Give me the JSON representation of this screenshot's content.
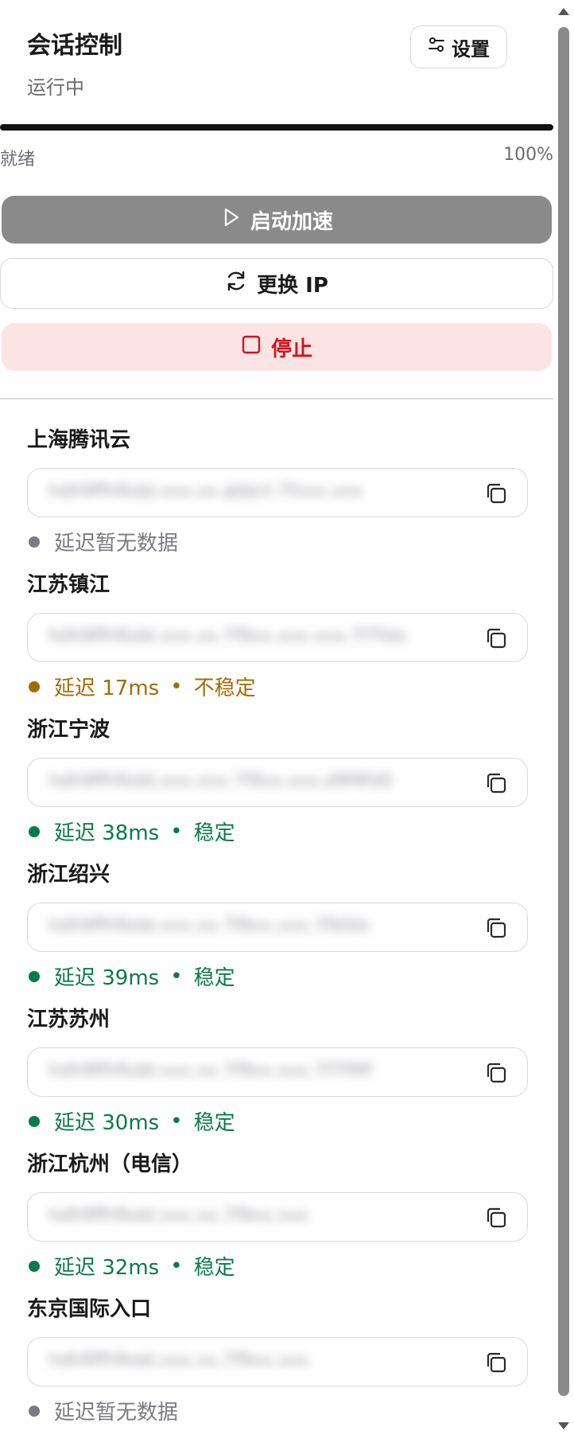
{
  "header": {
    "title": "会话控制",
    "status": "运行中",
    "settings_label": "设置"
  },
  "progress": {
    "label": "就绪",
    "percent_text": "100%",
    "value": 1.0
  },
  "actions": {
    "start_label": "启动加速",
    "change_ip_label": "更换 IP",
    "stop_label": "停止"
  },
  "colors": {
    "stable": "#0b7a4b",
    "unstable": "#a36b07",
    "none": "#7a7a82",
    "stop_text": "#d0141c",
    "stop_bg": "#fce4e4"
  },
  "nodes": [
    {
      "name": "上海腾讯云",
      "value": "hdh9ffhfkdd.xxx.xx.abbct.7fxxx.xxx",
      "latency_text": "延迟暂无数据",
      "stability": "",
      "status": "none"
    },
    {
      "name": "江苏镇江",
      "value": "hdh9ffhfkdd.xxx.xx.7f9xx.xxx.xxx.7f7fdx",
      "latency_text": "延迟 17ms",
      "stability": "不稳定",
      "status": "unstable"
    },
    {
      "name": "浙江宁波",
      "value": "hdh9ffhfkdd.xxx.xxx.7f9xx.xxx.d9f9fd0",
      "latency_text": "延迟 38ms",
      "stability": "稳定",
      "status": "stable"
    },
    {
      "name": "浙江绍兴",
      "value": "hdh9ffhfkdd.xxx.xx.7f9xx.xxx.7fbfdx",
      "latency_text": "延迟 39ms",
      "stability": "稳定",
      "status": "stable"
    },
    {
      "name": "江苏苏州",
      "value": "hdh9ffhfkdd.xxx.xx.7f9xx.xxx.7f7f9ff",
      "latency_text": "延迟 30ms",
      "stability": "稳定",
      "status": "stable"
    },
    {
      "name": "浙江杭州（电信）",
      "value": "hdh9ffhfkdd.xxx.xx.7f9xx.xxx",
      "latency_text": "延迟 32ms",
      "stability": "稳定",
      "status": "stable"
    },
    {
      "name": "东京国际入口",
      "value": "hdh9ffhfkdd.xxx.xx.7f9xx.xxx",
      "latency_text": "延迟暂无数据",
      "stability": "",
      "status": "none"
    }
  ]
}
